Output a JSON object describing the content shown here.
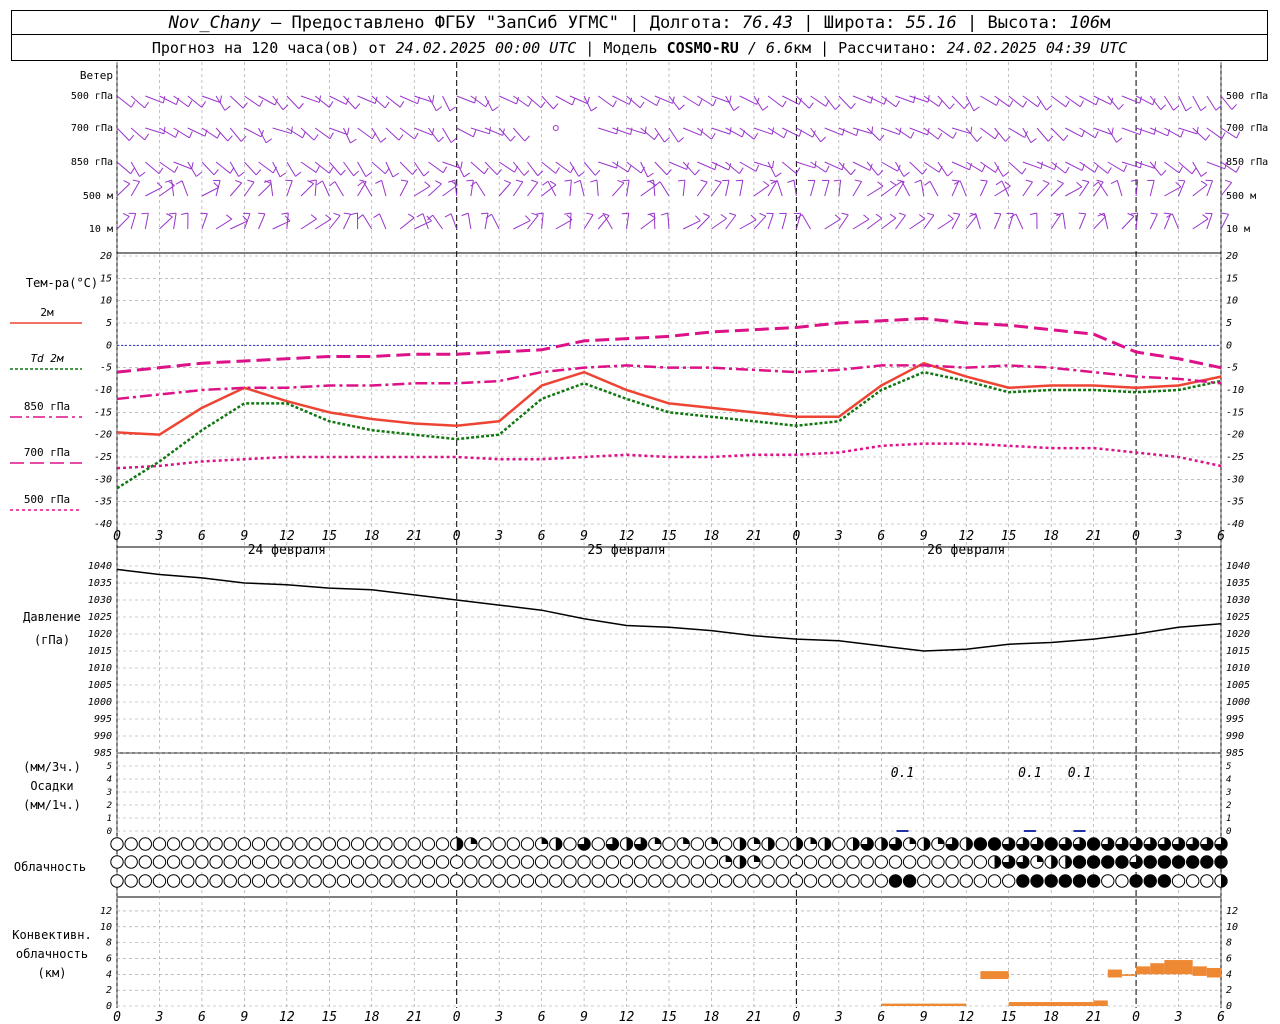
{
  "header": {
    "station": "Nov_Chany",
    "provider": " — Предоставлено ФГБУ \"ЗапСиб УГМС\" | ",
    "lon_label": "Долгота: ",
    "lon": "76.43",
    "lat_label": " | Широта: ",
    "lat": "55.16",
    "alt_label": " | Высота: ",
    "alt": "106",
    "alt_unit": "м",
    "forecast_label": "Прогноз на 120 часа(ов) от ",
    "init_time": "24.02.2025 00:00 UTC",
    "model_label": " | Модель ",
    "model": "COSMO-RU",
    "res": " / 6.6",
    "res_unit": "км",
    "calc_label": " | Рассчитано: ",
    "calc_time": "24.02.2025 04:39 UTC"
  },
  "colors": {
    "wind": "#9933cc",
    "t2m": "#ee4433",
    "td2m": "#117711",
    "t850": "#dd1188",
    "zero": "#3333cc",
    "pressure": "#000000",
    "convective": "#ee8833",
    "precip": "#2233aa",
    "grid": "#999999"
  },
  "x_axis": {
    "hour_ticks": [
      "0",
      "3",
      "6",
      "9",
      "12",
      "15",
      "18",
      "21",
      "0",
      "3",
      "6",
      "9",
      "12",
      "15",
      "18",
      "21",
      "0",
      "3",
      "6",
      "9",
      "12",
      "15",
      "18",
      "21",
      "0",
      "3",
      "6"
    ],
    "dates": [
      "24 февраля",
      "25 февраля",
      "26 февраля"
    ]
  },
  "labels": {
    "wind_title": "Ветер",
    "wind_levels": [
      "500 гПа",
      "700 гПа",
      "850 гПа",
      "500 м",
      "10 м"
    ],
    "temp_title": "Тем-ра(°С)",
    "legend": [
      {
        "name": "2м",
        "style": "t2m"
      },
      {
        "name": "Td  2м",
        "style": "td"
      },
      {
        "name": "850 гПа",
        "style": "t850"
      },
      {
        "name": "700 гПа",
        "style": "t700"
      },
      {
        "name": "500 гПа",
        "style": "t500"
      }
    ],
    "pressure_title": "Давление",
    "pressure_unit": "(гПа)",
    "precip_title": [
      "(мм/3ч.)",
      "Осадки",
      "(мм/1ч.)"
    ],
    "cloud_title": "Облачность",
    "conv_title": [
      "Конвективн.",
      "облачность",
      "(км)"
    ]
  },
  "chart_data": [
    {
      "type": "line",
      "name": "temperature",
      "x": [
        0,
        3,
        6,
        9,
        12,
        15,
        18,
        21,
        24,
        27,
        30,
        33,
        36,
        39,
        42,
        45,
        48,
        51,
        54,
        57,
        60,
        63,
        66,
        69,
        72,
        75,
        78
      ],
      "ylim": [
        -40,
        20
      ],
      "yticks": [
        20,
        15,
        10,
        5,
        0,
        -5,
        -10,
        -15,
        -20,
        -25,
        -30,
        -35,
        -40
      ],
      "series": [
        {
          "name": "2м",
          "values": [
            -19.5,
            -20,
            -14,
            -9.5,
            -12.5,
            -15,
            -16.5,
            -17.5,
            -18,
            -17,
            -9,
            -6,
            -10,
            -13,
            -14,
            -15,
            -16,
            -16,
            -9,
            -4,
            -7,
            -9.5,
            -9,
            -9,
            -9.5,
            -9,
            -7
          ]
        },
        {
          "name": "Td 2м",
          "values": [
            -32,
            -26,
            -19,
            -13,
            -13,
            -17,
            -19,
            -20,
            -21,
            -20,
            -12,
            -8.5,
            -12,
            -15,
            -16,
            -17,
            -18,
            -17,
            -10,
            -6,
            -8,
            -10.5,
            -10,
            -10,
            -10.5,
            -10,
            -8
          ]
        },
        {
          "name": "850 гПа",
          "values": [
            -12,
            -11,
            -10,
            -9.5,
            -9.5,
            -9,
            -9,
            -8.5,
            -8.5,
            -8,
            -6,
            -5,
            -4.5,
            -5,
            -5,
            -5.5,
            -6,
            -5.5,
            -4.5,
            -4.5,
            -5,
            -4.5,
            -5,
            -6,
            -7,
            -7.5,
            -8.5
          ]
        },
        {
          "name": "700 гПа",
          "values": [
            -6,
            -5,
            -4,
            -3.5,
            -3,
            -2.5,
            -2.5,
            -2,
            -2,
            -1.5,
            -1,
            1,
            1.5,
            2,
            3,
            3.5,
            4,
            5,
            5.5,
            6,
            5,
            4.5,
            3.5,
            2.5,
            -1.5,
            -3,
            -5
          ]
        },
        {
          "name": "500 гПа",
          "values": [
            -27.5,
            -27,
            -26,
            -25.5,
            -25,
            -25,
            -25,
            -25,
            -25,
            -25.5,
            -25.5,
            -25,
            -24.5,
            -25,
            -25,
            -24.5,
            -24.5,
            -24,
            -22.5,
            -22,
            -22,
            -22.5,
            -23,
            -23,
            -24,
            -25,
            -27
          ]
        }
      ]
    },
    {
      "type": "line",
      "name": "pressure",
      "x": [
        0,
        3,
        6,
        9,
        12,
        15,
        18,
        21,
        24,
        27,
        30,
        33,
        36,
        39,
        42,
        45,
        48,
        51,
        54,
        57,
        60,
        63,
        66,
        69,
        72,
        75,
        78
      ],
      "ylim": [
        985,
        1040
      ],
      "yticks": [
        1040,
        1035,
        1030,
        1025,
        1020,
        1015,
        1010,
        1005,
        1000,
        995,
        990,
        985
      ],
      "series": [
        {
          "name": "Давление",
          "values": [
            1039,
            1037.5,
            1036.5,
            1035,
            1034.5,
            1033.5,
            1033,
            1031.5,
            1030,
            1028.5,
            1027,
            1024.5,
            1022.5,
            1022,
            1021,
            1019.5,
            1018.5,
            1018,
            1016.5,
            1015,
            1015.5,
            1017,
            1017.5,
            1018.5,
            1020,
            1022,
            1023
          ]
        }
      ]
    },
    {
      "type": "bar",
      "name": "precipitation",
      "ylim": [
        0,
        5
      ],
      "yticks": [
        5,
        4,
        3,
        2,
        1,
        0
      ],
      "annotations": [
        {
          "x": 55.5,
          "text": "0.1"
        },
        {
          "x": 64.5,
          "text": "0.1"
        },
        {
          "x": 68,
          "text": "0.1"
        }
      ]
    },
    {
      "type": "bar",
      "name": "convective_cloud",
      "ylim": [
        0,
        13
      ],
      "yticks": [
        12,
        10,
        8,
        6,
        4,
        2,
        0
      ],
      "bars": [
        {
          "x0": 54,
          "x1": 60,
          "bottom": 0,
          "top": 0.3
        },
        {
          "x0": 61,
          "x1": 63,
          "bottom": 3.4,
          "top": 4.4
        },
        {
          "x0": 63,
          "x1": 69,
          "bottom": 0,
          "top": 0.5
        },
        {
          "x0": 69,
          "x1": 70,
          "bottom": 0,
          "top": 0.7
        },
        {
          "x0": 70,
          "x1": 71,
          "bottom": 3.6,
          "top": 4.6
        },
        {
          "x0": 71,
          "x1": 72,
          "bottom": 3.8,
          "top": 4.0
        },
        {
          "x0": 72,
          "x1": 73,
          "bottom": 4.0,
          "top": 5.0
        },
        {
          "x0": 73,
          "x1": 74,
          "bottom": 4.0,
          "top": 5.4
        },
        {
          "x0": 74,
          "x1": 76,
          "bottom": 4.0,
          "top": 5.8
        },
        {
          "x0": 76,
          "x1": 77,
          "bottom": 3.8,
          "top": 5.0
        },
        {
          "x0": 77,
          "x1": 78,
          "bottom": 3.6,
          "top": 4.8
        }
      ]
    },
    {
      "type": "table",
      "name": "cloudiness",
      "rows": [
        "upper",
        "middle",
        "lower"
      ],
      "step_hours": 1,
      "upper_fill": {
        "0-24": 0,
        "24": 0.5,
        "25": 0.25,
        "26": 0,
        "30": 0.25,
        "31": 0.5,
        "32": 0,
        "33": 0.75,
        "34": 0,
        "35": 0.75,
        "36": 0.5,
        "37": 0.75,
        "38": 0.25,
        "39": 0,
        "40": 0.25,
        "41": 0,
        "42": 0.25,
        "43": 0,
        "44": 0.5,
        "45": 0.25,
        "46": 0.5,
        "47": 0,
        "48": 0.5,
        "49": 0.25,
        "50": 0.5,
        "51": 0,
        "52": 0.5,
        "53": 0.75,
        "54": 0.5,
        "55": 0.75,
        "56": 0.25,
        "57": 0.5,
        "58": 0.25,
        "59": 0.75,
        "60": 0.5,
        "61": 1,
        "62": 1,
        "63": 0.75,
        "64": 0.75,
        "65": 0.75,
        "66": 1,
        "67": 0.75,
        "68": 0.75,
        "69": 1,
        "70": 0.75,
        "71": 0.75,
        "72": 0.75,
        "73": 0.75,
        "74": 0.75,
        "75": 0.75,
        "76": 0.75,
        "77": 0.75,
        "78": 0.75
      },
      "middle_fill": {
        "0-42": 0,
        "43": 0.25,
        "44": 0.5,
        "45": 0.25,
        "46-61": 0,
        "62": 0.5,
        "63": 0.75,
        "64": 0.75,
        "65": 0.25,
        "66": 0.5,
        "67": 0.5,
        "68": 1,
        "69": 1,
        "70": 1,
        "71": 1,
        "72": 0.75,
        "73": 1,
        "74": 1,
        "75": 1,
        "76": 1,
        "77": 1,
        "78": 1
      },
      "lower_fill": {
        "0-54": 0,
        "55": 1,
        "56": 1,
        "57-63": 0,
        "64": 1,
        "65": 1,
        "66": 1,
        "67": 1,
        "68": 1,
        "69": 1,
        "70": 0,
        "71": 0,
        "72": 1,
        "73": 1,
        "74": 1,
        "75": 0,
        "76": 0,
        "77": 0,
        "78": 0.5
      }
    },
    {
      "type": "scatter",
      "name": "wind_barbs",
      "levels": [
        "500 гПа",
        "700 гПа",
        "850 гПа",
        "500 м",
        "10 м"
      ],
      "note_calm": {
        "level": "700 гПа",
        "x": 31
      }
    }
  ]
}
